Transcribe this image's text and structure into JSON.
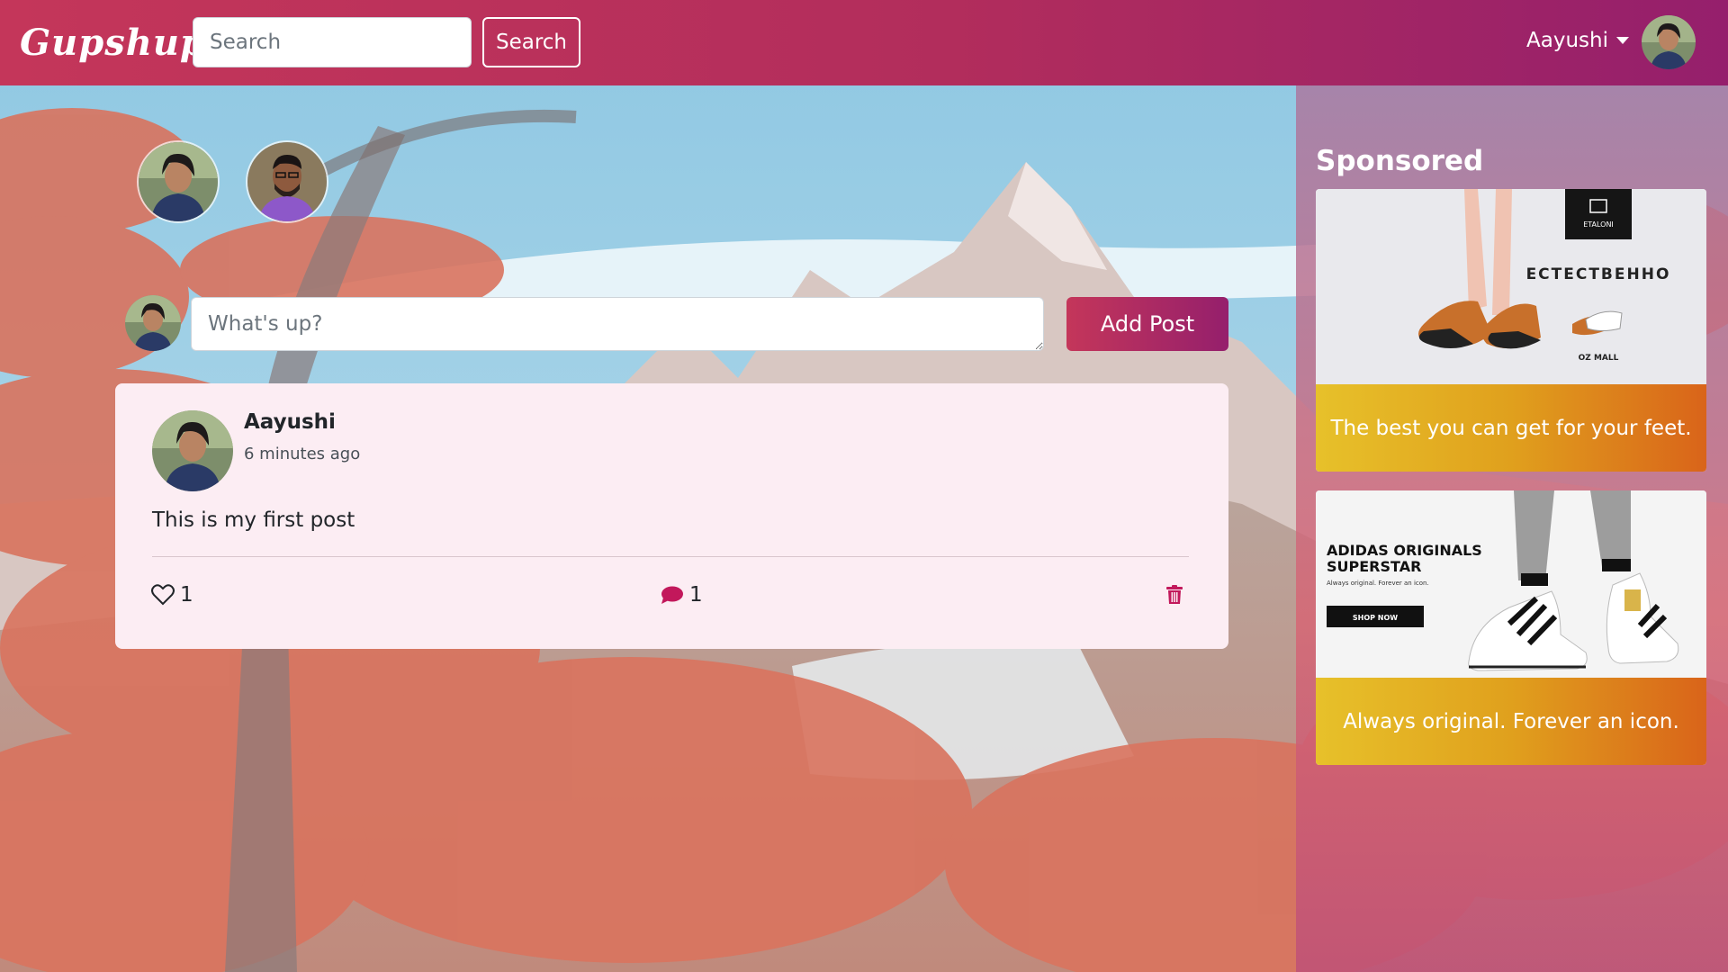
{
  "brand": "Gupshup",
  "nav": {
    "search_placeholder": "Search",
    "search_button": "Search",
    "username": "Aayushi"
  },
  "composer": {
    "placeholder": "What's up?",
    "add_button": "Add Post"
  },
  "post": {
    "author": "Aayushi",
    "time": "6 minutes ago",
    "body": "This is my first post",
    "likes": "1",
    "comments": "1"
  },
  "sidebar": {
    "title": "Sponsored",
    "ads": [
      {
        "caption": "The best you can get for your feet.",
        "image_brand": "ETALONI",
        "image_word": "ЕСТЕСТВЕННО",
        "image_place": "OZ MALL"
      },
      {
        "caption": "Always original. Forever an icon.",
        "image_title_1": "ADIDAS ORIGINALS",
        "image_title_2": "SUPERSTAR",
        "image_tagline": "Always original. Forever an icon.",
        "image_button": "SHOP NOW"
      }
    ]
  },
  "colors": {
    "accent_start": "#c4365a",
    "accent_end": "#951f6c",
    "card_bg": "#fcedf3",
    "comment_icon": "#c2185b",
    "ad_caption_start": "#e7c12a",
    "ad_caption_end": "#d9641a"
  },
  "icons": [
    "heart-icon",
    "comment-icon",
    "trash-icon",
    "caret-down-icon"
  ]
}
